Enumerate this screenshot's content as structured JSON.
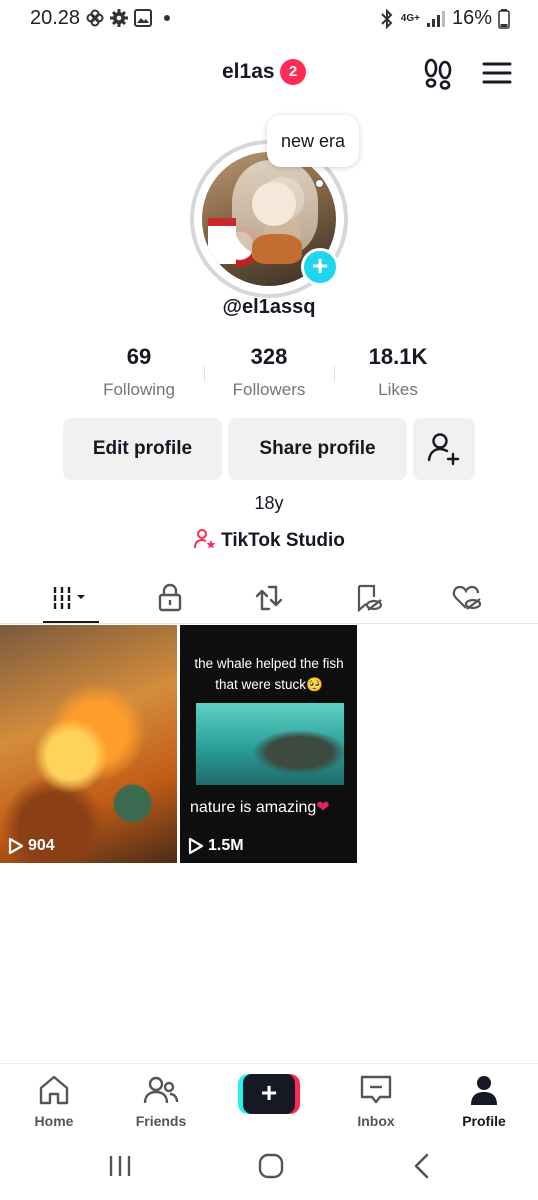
{
  "status_bar": {
    "time": "20.28",
    "battery": "16%",
    "network": "4G+"
  },
  "header": {
    "username": "el1as",
    "notification_count": "2"
  },
  "profile": {
    "note": "new era",
    "handle": "@el1assq",
    "bio": "18y",
    "studio_link": "TikTok Studio"
  },
  "stats": [
    {
      "value": "69",
      "label": "Following"
    },
    {
      "value": "328",
      "label": "Followers"
    },
    {
      "value": "18.1K",
      "label": "Likes"
    }
  ],
  "actions": {
    "edit_label": "Edit profile",
    "share_label": "Share profile"
  },
  "tabs": [
    {
      "icon": "grid-icon",
      "active": true
    },
    {
      "icon": "lock-icon",
      "active": false
    },
    {
      "icon": "repost-icon",
      "active": false
    },
    {
      "icon": "bookmark-hidden-icon",
      "active": false
    },
    {
      "icon": "heart-hidden-icon",
      "active": false
    }
  ],
  "videos": [
    {
      "views": "904"
    },
    {
      "views": "1.5M",
      "caption_top": "the whale helped the fish that were stuck🥺",
      "caption_bottom": "nature is amazing"
    }
  ],
  "bottom_nav": {
    "home": "Home",
    "friends": "Friends",
    "inbox": "Inbox",
    "profile": "Profile"
  },
  "colors": {
    "accent": "#fe2c55",
    "cyan": "#20d5ec",
    "text": "#161823",
    "muted": "#757575"
  }
}
